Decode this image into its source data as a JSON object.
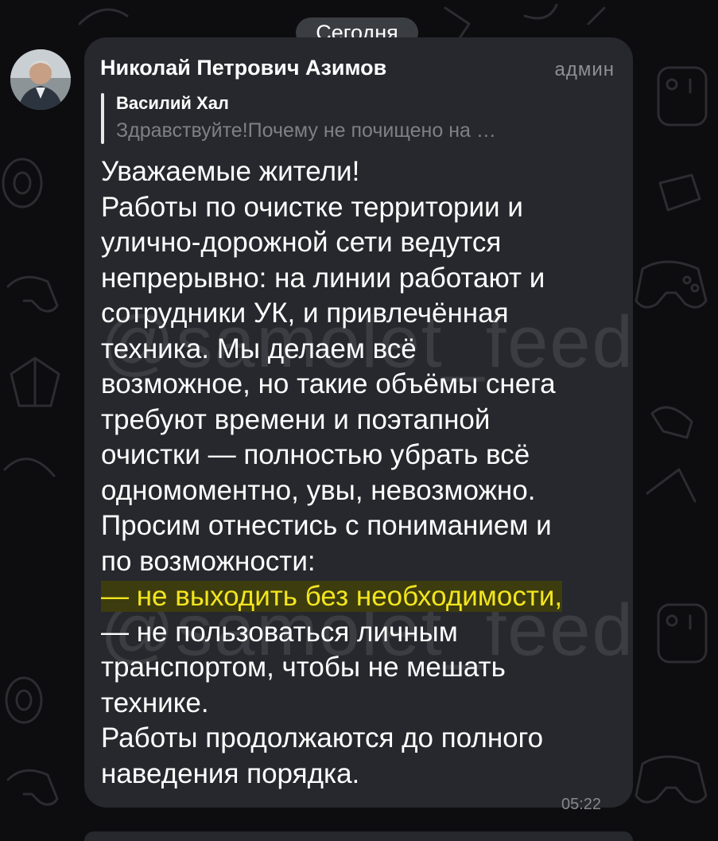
{
  "date_pill": "Сегодня",
  "message": {
    "author": "Николай Петрович Азимов",
    "role": "админ",
    "reply": {
      "name": "Василий Хал",
      "text": "Здравствуйте!Почему не почищено на …"
    },
    "lines": [
      "Уважаемые жители!",
      "Работы по очистке территории и",
      "улично-дорожной сети ведутся",
      "непрерывно: на линии работают и",
      "сотрудники УК, и привлечённая",
      "техника. Мы делаем всё",
      "возможное, но такие объёмы снега",
      "требуют времени и поэтапной",
      "очистки — полностью убрать всё",
      "одномоментно, увы, невозможно.",
      "Просим отнестись с пониманием и",
      "по возможности:",
      "— не выходить без необходимости,",
      "— не пользоваться личным",
      "транспортом, чтобы не мешать",
      "технике.",
      "Работы продолжаются до полного",
      "наведения порядка."
    ],
    "time": "05:22"
  },
  "watermark": "@samolet_feed",
  "colors": {
    "background": "#0d0d0f",
    "bubble": "#26282d",
    "highlight_text": "#f2e51e",
    "highlight_bg": "#3d3c0f"
  }
}
